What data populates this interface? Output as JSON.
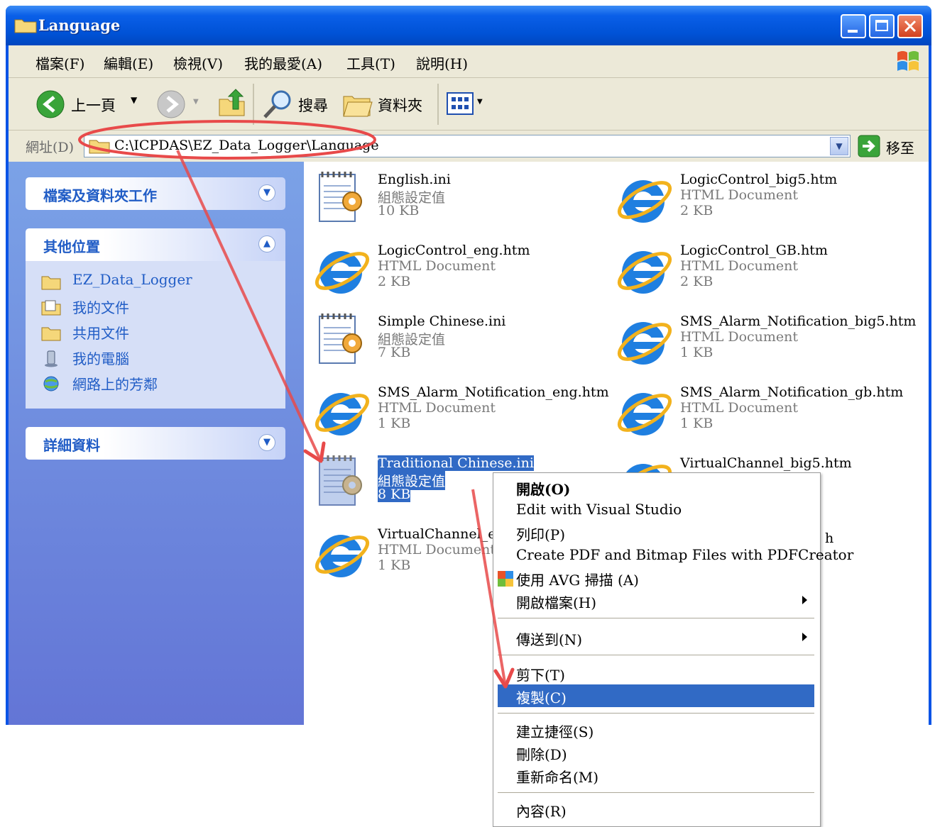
{
  "window": {
    "title": "Language"
  },
  "menubar": {
    "items": [
      "檔案(F)",
      "編輯(E)",
      "檢視(V)",
      "我的最愛(A)",
      "工具(T)",
      "說明(H)"
    ]
  },
  "toolbar": {
    "back_label": "上一頁",
    "search_label": "搜尋",
    "folders_label": "資料夾"
  },
  "address": {
    "label": "網址(D)",
    "path": "C:\\ICPDAS\\EZ_Data_Logger\\Language",
    "go_label": "移至"
  },
  "sidebar": {
    "tasks": {
      "title": "檔案及資料夾工作"
    },
    "other_places": {
      "title": "其他位置",
      "items": [
        {
          "label": "EZ_Data_Logger",
          "icon": "folder-icon"
        },
        {
          "label": "我的文件",
          "icon": "my-documents-icon"
        },
        {
          "label": "共用文件",
          "icon": "folder-icon"
        },
        {
          "label": "我的電腦",
          "icon": "my-computer-icon"
        },
        {
          "label": "網路上的芳鄰",
          "icon": "network-icon"
        }
      ]
    },
    "details": {
      "title": "詳細資料"
    }
  },
  "files": [
    {
      "name": "English.ini",
      "type": "組態設定值",
      "size": "10 KB",
      "icon": "ini-settings-icon"
    },
    {
      "name": "LogicControl_big5.htm",
      "type": "HTML Document",
      "size": "2 KB",
      "icon": "ie-html-icon"
    },
    {
      "name": "LogicControl_eng.htm",
      "type": "HTML Document",
      "size": "2 KB",
      "icon": "ie-html-icon"
    },
    {
      "name": "LogicControl_GB.htm",
      "type": "HTML Document",
      "size": "2 KB",
      "icon": "ie-html-icon"
    },
    {
      "name": "Simple Chinese.ini",
      "type": "組態設定值",
      "size": "7 KB",
      "icon": "ini-settings-icon"
    },
    {
      "name": "SMS_Alarm_Notification_big5.htm",
      "type": "HTML Document",
      "size": "1 KB",
      "icon": "ie-html-icon"
    },
    {
      "name": "SMS_Alarm_Notification_eng.htm",
      "type": "HTML Document",
      "size": "1 KB",
      "icon": "ie-html-icon"
    },
    {
      "name": "SMS_Alarm_Notification_gb.htm",
      "type": "HTML Document",
      "size": "1 KB",
      "icon": "ie-html-icon"
    },
    {
      "name": "Traditional Chinese.ini",
      "type": "組態設定值",
      "size": "8 KB",
      "icon": "ini-settings-icon",
      "selected": true
    },
    {
      "name": "VirtualChannel_big5.htm",
      "type": "",
      "size": "",
      "icon": "ie-html-icon"
    },
    {
      "name": "VirtualChannel_eng",
      "type": "HTML Document",
      "size": "1 KB",
      "icon": "ie-html-icon"
    },
    {
      "name": "h",
      "type": "",
      "size": "",
      "icon": ""
    }
  ],
  "context_menu": {
    "items": [
      {
        "label": "開啟(O)",
        "bold": true
      },
      {
        "label": "Edit with Visual Studio"
      },
      {
        "label": "列印(P)"
      },
      {
        "label": "Create PDF and Bitmap Files with PDFCreator"
      },
      {
        "label": "使用 AVG 掃描 (A)",
        "icon": "avg-icon"
      },
      {
        "label": "開啟檔案(H)",
        "submenu": true
      },
      {
        "label": "傳送到(N)",
        "submenu": true
      },
      {
        "label": "剪下(T)"
      },
      {
        "label": "複製(C)",
        "highlighted": true
      },
      {
        "label": "建立捷徑(S)"
      },
      {
        "label": "刪除(D)"
      },
      {
        "label": "重新命名(M)"
      },
      {
        "label": "內容(R)"
      }
    ]
  },
  "colors": {
    "title_bar": "#0a54e6",
    "sidebar": "#6f8fe0",
    "selection": "#316ac5",
    "annotation": "#e84a4a"
  }
}
